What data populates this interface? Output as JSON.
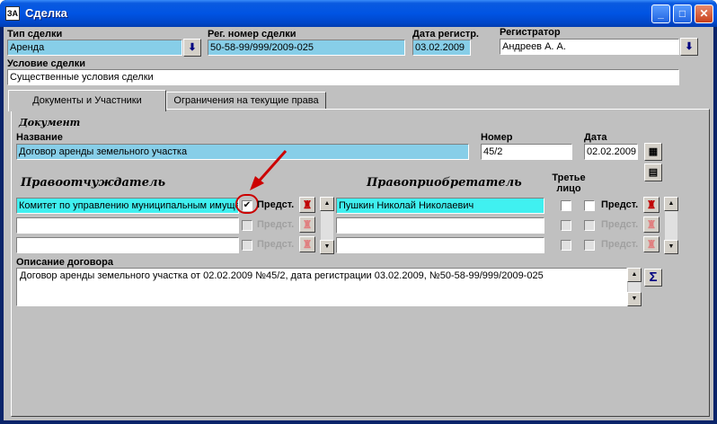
{
  "window": {
    "title": "Сделка",
    "icon_text": "ЗА"
  },
  "top": {
    "deal_type_label": "Тип сделки",
    "deal_type_value": "Аренда",
    "reg_number_label": "Рег. номер сделки",
    "reg_number_value": "50-58-99/999/2009-025",
    "reg_date_label": "Дата регистр.",
    "reg_date_value": "03.02.2009",
    "registrar_label": "Регистратор",
    "registrar_value": "Андреев А. А.",
    "condition_label": "Условие сделки",
    "condition_value": "Существенные условия сделки"
  },
  "tabs": [
    {
      "label": "Документы и Участники"
    },
    {
      "label": "Ограничения на текущие права"
    }
  ],
  "document": {
    "section_label": "Документ",
    "name_label": "Название",
    "name_value": "Договор аренды земельного участка",
    "number_label": "Номер",
    "number_value": "45/2",
    "date_label": "Дата",
    "date_value": "02.02.2009"
  },
  "parties": {
    "grantor_label": "Правоотчуждатель",
    "grantee_label": "Правоприобретатель",
    "third_party_label": "Третье лицо",
    "grantor_rows": [
      {
        "value": "Комитет по управлению муниципальным имуще",
        "pred": "Предст.",
        "checked": "✔"
      },
      {
        "value": "",
        "pred": "Предст."
      },
      {
        "value": "",
        "pred": "Предст."
      }
    ],
    "grantee_rows": [
      {
        "value": "Пушкин Николай Николаевич",
        "pred": "Предст."
      },
      {
        "value": "",
        "pred": "Предст."
      },
      {
        "value": "",
        "pred": "Предст."
      }
    ]
  },
  "description": {
    "label": "Описание договора",
    "value": "Договор аренды земельного участка от 02.02.2009 №45/2, дата регистрации 03.02.2009, №50-58-99/999/2009-025",
    "sum_symbol": "Σ"
  },
  "colors": {
    "accent_red": "#cc0000",
    "field_blue": "#87cee8",
    "field_cyan": "#40f0f0"
  }
}
